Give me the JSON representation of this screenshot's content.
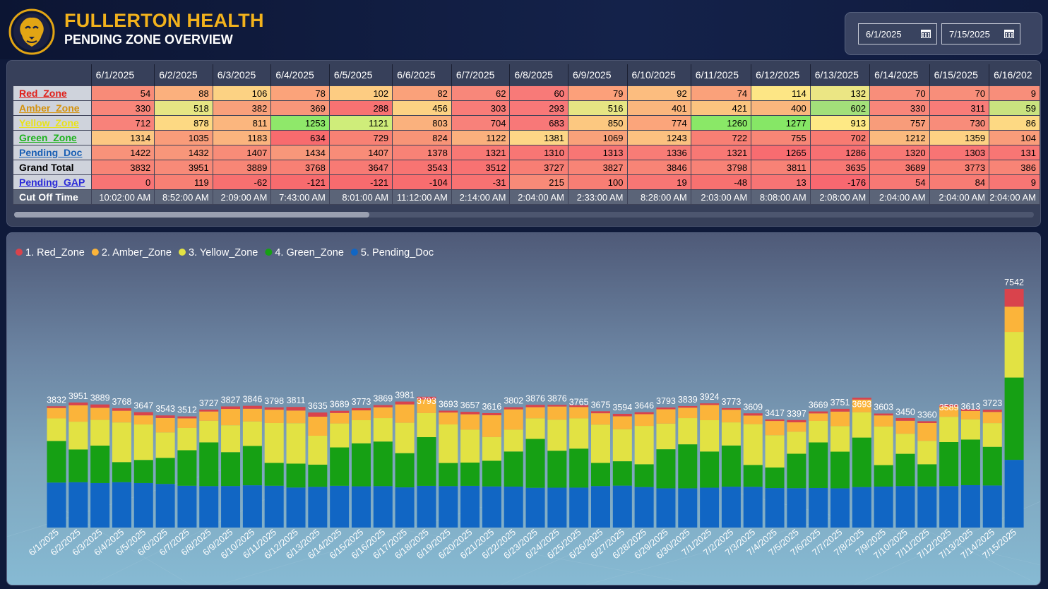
{
  "header": {
    "title": "FULLERTON HEALTH",
    "subtitle": "PENDING ZONE OVERVIEW",
    "logo_icon": "lion-logo-icon",
    "brand_color": "#f2b21c"
  },
  "date_filter": {
    "start": "6/1/2025",
    "end": "7/15/2025",
    "icon": "calendar-icon"
  },
  "matrix": {
    "dates": [
      "6/1/2025",
      "6/2/2025",
      "6/3/2025",
      "6/4/2025",
      "6/5/2025",
      "6/6/2025",
      "6/7/2025",
      "6/8/2025",
      "6/9/2025",
      "6/10/2025",
      "6/11/2025",
      "6/12/2025",
      "6/13/2025",
      "6/14/2025",
      "6/15/2025",
      "6/16/202"
    ],
    "rows": [
      {
        "label": "Red_Zone",
        "color": "#e0201a",
        "underline": true,
        "values": [
          "54",
          "88",
          "106",
          "78",
          "102",
          "82",
          "62",
          "60",
          "79",
          "92",
          "74",
          "114",
          "132",
          "70",
          "70",
          "9"
        ],
        "bg": [
          "#f88b78",
          "#fbb07d",
          "#fcd283",
          "#fba37a",
          "#fdcc82",
          "#faa17a",
          "#f8877a",
          "#f87a78",
          "#fca07a",
          "#fcbd7f",
          "#faa17a",
          "#fde685",
          "#ebe684",
          "#f88e7a",
          "#f88e7a",
          "#f88e7a"
        ]
      },
      {
        "label": "Amber_Zone",
        "color": "#d4920e",
        "underline": true,
        "values": [
          "330",
          "518",
          "382",
          "369",
          "288",
          "456",
          "303",
          "293",
          "516",
          "401",
          "421",
          "400",
          "602",
          "330",
          "311",
          "59"
        ],
        "bg": [
          "#f8867a",
          "#e6e583",
          "#f9a07b",
          "#f8967a",
          "#f87272",
          "#fcd283",
          "#f87c78",
          "#f87878",
          "#e6e583",
          "#fab67d",
          "#fbc47f",
          "#fab67d",
          "#a3e07a",
          "#f8867a",
          "#f87c78",
          "#c9e27f"
        ]
      },
      {
        "label": "Yellow_Zone",
        "color": "#e8e21a",
        "underline": true,
        "values": [
          "712",
          "878",
          "811",
          "1253",
          "1121",
          "803",
          "704",
          "683",
          "850",
          "774",
          "1260",
          "1277",
          "913",
          "757",
          "730",
          "86"
        ],
        "bg": [
          "#f8827a",
          "#fdd983",
          "#fbb67e",
          "#8fe86a",
          "#cfed7a",
          "#fab17d",
          "#f8817a",
          "#f87878",
          "#fcc880",
          "#fba57b",
          "#8ae867",
          "#86e766",
          "#fee985",
          "#f89c7a",
          "#f88c7a",
          "#fdd983"
        ]
      },
      {
        "label": "Green_Zone",
        "color": "#1db31d",
        "underline": true,
        "values": [
          "1314",
          "1035",
          "1183",
          "634",
          "729",
          "824",
          "1122",
          "1381",
          "1069",
          "1243",
          "722",
          "755",
          "702",
          "1212",
          "1359",
          "104"
        ],
        "bg": [
          "#fcc782",
          "#f99c7a",
          "#fbb47e",
          "#f86b6e",
          "#f88174",
          "#f89477",
          "#fab07d",
          "#fdd686",
          "#f9a17a",
          "#fcc180",
          "#f87f74",
          "#f88676",
          "#f87b72",
          "#fbba7e",
          "#fdd283",
          "#f99c7a"
        ]
      },
      {
        "label": "Pending_Doc",
        "color": "#1a5fb4",
        "underline": true,
        "values": [
          "1422",
          "1432",
          "1407",
          "1434",
          "1407",
          "1378",
          "1321",
          "1310",
          "1313",
          "1336",
          "1321",
          "1265",
          "1286",
          "1320",
          "1303",
          "131"
        ],
        "bg": [
          "#f8927a",
          "#f8967a",
          "#f88c78",
          "#f8977a",
          "#f88c78",
          "#f88276",
          "#f87874",
          "#f87674",
          "#f87674",
          "#f87c76",
          "#f87874",
          "#f86c70",
          "#f87072",
          "#f87874",
          "#f87474",
          "#f87674"
        ]
      },
      {
        "label": "Grand Total",
        "color": "#000000",
        "underline": false,
        "values": [
          "3832",
          "3951",
          "3889",
          "3768",
          "3647",
          "3543",
          "3512",
          "3727",
          "3827",
          "3846",
          "3798",
          "3811",
          "3635",
          "3689",
          "3773",
          "386"
        ],
        "bg": [
          "#f88476",
          "#f88a78",
          "#f88676",
          "#f88074",
          "#f87a74",
          "#f87472",
          "#f87272",
          "#f87e74",
          "#f88476",
          "#f88476",
          "#f88276",
          "#f88276",
          "#f87874",
          "#f87c74",
          "#f88074",
          "#f88476"
        ]
      },
      {
        "label": "Pending_GAP",
        "color": "#2a2ad8",
        "underline": true,
        "values": [
          "0",
          "119",
          "-62",
          "-121",
          "-121",
          "-104",
          "-31",
          "215",
          "100",
          "19",
          "-48",
          "13",
          "-176",
          "54",
          "84",
          "9"
        ],
        "bg": [
          "#f87474",
          "#f88074",
          "#f87070",
          "#f86b6e",
          "#f86b6e",
          "#f86d6f",
          "#f87272",
          "#f88a78",
          "#f87e74",
          "#f87674",
          "#f87170",
          "#f87474",
          "#f86870",
          "#f87874",
          "#f87c74",
          "#f87674"
        ]
      },
      {
        "label": "Cut Off Time",
        "color": "#ffffff",
        "underline": false,
        "values": [
          "10:02:00 AM",
          "8:52:00 AM",
          "2:09:00 AM",
          "7:43:00 AM",
          "8:01:00 AM",
          "11:12:00 AM",
          "2:14:00 AM",
          "2:04:00 AM",
          "2:33:00 AM",
          "8:28:00 AM",
          "2:03:00 AM",
          "8:08:00 AM",
          "2:08:00 AM",
          "2:04:00 AM",
          "2:04:00 AM",
          "2:04:00 AM"
        ]
      }
    ]
  },
  "legend": [
    {
      "label": "1. Red_Zone",
      "color": "#d9434c"
    },
    {
      "label": "2. Amber_Zone",
      "color": "#fbb43a"
    },
    {
      "label": "3. Yellow_Zone",
      "color": "#e2e243"
    },
    {
      "label": "4. Green_Zone",
      "color": "#16a014"
    },
    {
      "label": "5. Pending_Doc",
      "color": "#1166c4"
    }
  ],
  "chart_data": {
    "type": "bar",
    "stacked": true,
    "categories": [
      "6/1/2025",
      "6/2/2025",
      "6/3/2025",
      "6/4/2025",
      "6/5/2025",
      "6/6/2025",
      "6/7/2025",
      "6/8/2025",
      "6/9/2025",
      "6/10/2025",
      "6/11/2025",
      "6/12/2025",
      "6/13/2025",
      "6/14/2025",
      "6/15/2025",
      "6/16/2025",
      "6/17/2025",
      "6/18/2025",
      "6/19/2025",
      "6/20/2025",
      "6/21/2025",
      "6/22/2025",
      "6/23/2025",
      "6/24/2025",
      "6/25/2025",
      "6/26/2025",
      "6/27/2025",
      "6/28/2025",
      "6/29/2025",
      "6/30/2025",
      "7/1/2025",
      "7/2/2025",
      "7/3/2025",
      "7/4/2025",
      "7/5/2025",
      "7/6/2025",
      "7/7/2025",
      "7/8/2025",
      "7/9/2025",
      "7/10/2025",
      "7/11/2025",
      "7/12/2025",
      "7/13/2025",
      "7/14/2025",
      "7/15/2025"
    ],
    "totals": [
      3832,
      3951,
      3889,
      3768,
      3647,
      3543,
      3512,
      3727,
      3827,
      3846,
      3798,
      3811,
      3635,
      3689,
      3773,
      3869,
      3981,
      3793,
      3693,
      3657,
      3616,
      3802,
      3876,
      3876,
      3765,
      3675,
      3594,
      3646,
      3793,
      3839,
      3924,
      3773,
      3609,
      3417,
      3397,
      3669,
      3751,
      3693,
      3603,
      3450,
      3360,
      3589,
      3613,
      3723,
      7542
    ],
    "series": [
      {
        "name": "5. Pending_Doc",
        "values": [
          1422,
          1432,
          1407,
          1434,
          1407,
          1378,
          1321,
          1310,
          1313,
          1336,
          1321,
          1265,
          1286,
          1320,
          1303,
          1310,
          1270,
          1318,
          1310,
          1318,
          1300,
          1295,
          1256,
          1260,
          1262,
          1312,
          1325,
          1280,
          1240,
          1240,
          1260,
          1292,
          1288,
          1248,
          1244,
          1250,
          1240,
          1280,
          1295,
          1310,
          1300,
          1310,
          1340,
          1330,
          2140
        ]
      },
      {
        "name": "4. Green_Zone",
        "values": [
          1314,
          1035,
          1183,
          634,
          729,
          824,
          1122,
          1381,
          1069,
          1243,
          722,
          755,
          702,
          1212,
          1359,
          1408,
          1081,
          1538,
          730,
          735,
          811,
          1108,
          1545,
          1168,
          1232,
          730,
          770,
          720,
          1234,
          1390,
          1142,
          1301,
          690,
          650,
          1088,
          1440,
          1158,
          1563,
          678,
          1020,
          700,
          1390,
          1440,
          1220,
          2600
        ]
      },
      {
        "name": "3. Yellow_Zone",
        "values": [
          712,
          878,
          811,
          1253,
          1121,
          803,
          704,
          683,
          850,
          774,
          1260,
          1277,
          913,
          757,
          730,
          740,
          960,
          760,
          1218,
          1040,
          748,
          690,
          650,
          978,
          955,
          1210,
          1010,
          1212,
          810,
          828,
          990,
          730,
          1289,
          1020,
          695,
          680,
          808,
          800,
          1220,
          634,
          740,
          800,
          640,
          750,
          1440
        ]
      },
      {
        "name": "2. Amber_Zone",
        "values": [
          330,
          518,
          382,
          369,
          288,
          456,
          303,
          293,
          516,
          401,
          421,
          400,
          602,
          330,
          311,
          343,
          580,
          433,
          377,
          486,
          690,
          642,
          352,
          418,
          360,
          360,
          410,
          370,
          453,
          330,
          480,
          400,
          272,
          450,
          298,
          237,
          458,
          400,
          350,
          410,
          563,
          325,
          263,
          353,
          800
        ]
      },
      {
        "name": "1. Red_Zone",
        "values": [
          54,
          88,
          106,
          78,
          102,
          82,
          62,
          60,
          79,
          92,
          74,
          114,
          132,
          70,
          70,
          68,
          90,
          84,
          58,
          78,
          67,
          67,
          73,
          52,
          56,
          63,
          79,
          64,
          56,
          51,
          52,
          50,
          70,
          49,
          72,
          62,
          87,
          60,
          60,
          86,
          57,
          54,
          60,
          70,
          562
        ]
      }
    ],
    "xlabel": "",
    "ylabel": "",
    "legend_position": "top-left",
    "grid": false
  }
}
